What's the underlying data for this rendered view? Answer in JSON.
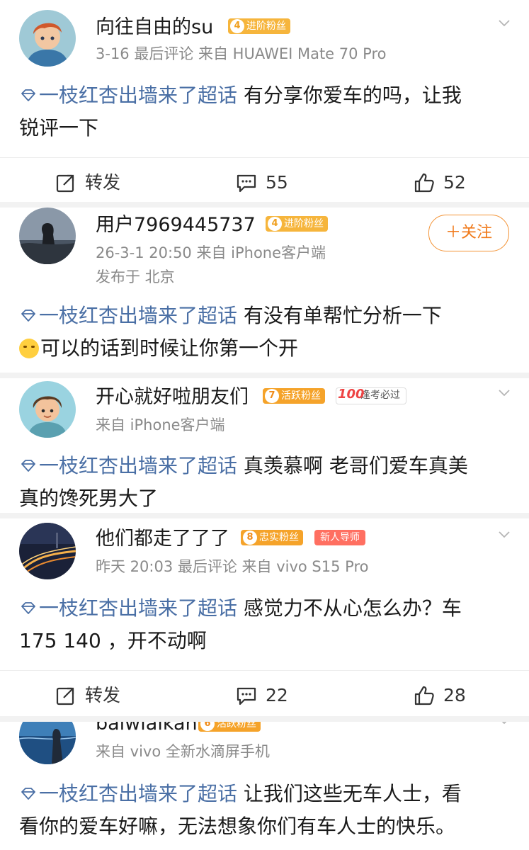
{
  "posts": [
    {
      "username": "向往自由的su",
      "badges": [
        {
          "level": "4",
          "text": "进阶粉丝"
        }
      ],
      "meta": "3-16 最后评论   来自 HUAWEI Mate 70 Pro",
      "topic": "一枝红杏出墙来了超话",
      "text_line1": " 有分享你爱车的吗，让我",
      "text_line2": "锐评一下",
      "actions": {
        "repost": "转发",
        "comments": "55",
        "likes": "52"
      }
    },
    {
      "username": "用户7969445737",
      "badges": [
        {
          "level": "4",
          "text": "进阶粉丝"
        }
      ],
      "meta": "26-3-1 20:50  来自 iPhone客户端",
      "location": "发布于 北京",
      "follow_label": "＋关注",
      "topic": "一枝红杏出墙来了超话",
      "text_line1": "  有没有单帮忙分析一下",
      "text_line2": "可以的话到时候让你第一个开"
    },
    {
      "username": "开心就好啦朋友们",
      "badges": [
        {
          "level": "7",
          "text": "活跃粉丝"
        },
        {
          "icon": "100",
          "text": "逢考必过"
        }
      ],
      "meta": "来自 iPhone客户端",
      "topic": "一枝红杏出墙来了超话",
      "text_line1": "  真羡慕啊 老哥们爱车真美",
      "text_line2": "真的馋死男大了"
    },
    {
      "username": "他们都走了了了",
      "badges": [
        {
          "level": "8",
          "text": "忠实粉丝"
        },
        {
          "text": "新人导师"
        }
      ],
      "meta": "昨天 20:03 最后评论   来自 vivo S15 Pro",
      "topic": "一枝红杏出墙来了超话",
      "text_line1": " 感觉力不从心怎么办？车",
      "text_line2": "175  140 ，开不动啊",
      "actions": {
        "repost": "转发",
        "comments": "22",
        "likes": "28"
      }
    },
    {
      "username": "baiwiaikan",
      "badges": [
        {
          "level": "6",
          "text": "活跃粉丝"
        }
      ],
      "meta": "来自 vivo 全新水滴屏手机",
      "topic": "一枝红杏出墙来了超话",
      "text_line1": " 让我们这些无车人士，看",
      "text_line2": "看你的爱车好嘛，无法想象你们有车人士的快乐。"
    }
  ],
  "colors": {
    "topic": "#4a6fa5",
    "meta": "#8a8a8a",
    "follow": "#f07a1a",
    "badge_gold": "#f6b53c",
    "badge_mentor": "#ff6f61"
  }
}
